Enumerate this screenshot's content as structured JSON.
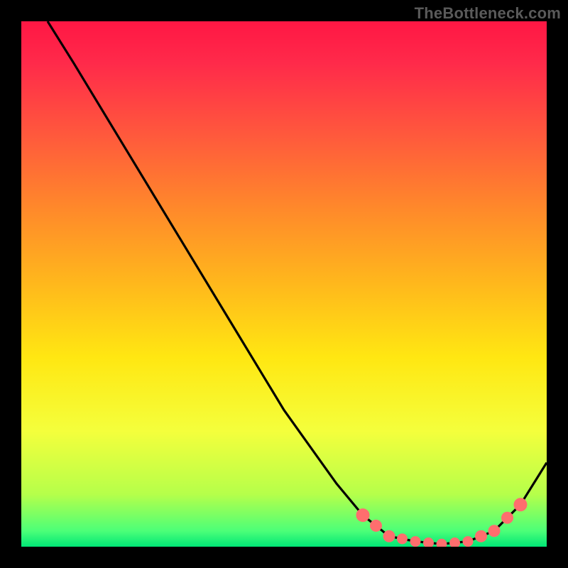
{
  "watermark": "TheBottleneck.com",
  "chart_data": {
    "type": "line",
    "title": "",
    "xlabel": "",
    "ylabel": "",
    "xlim": [
      0,
      100
    ],
    "ylim": [
      0,
      100
    ],
    "grid": false,
    "legend_position": "none",
    "annotations": [
      {
        "text": "TheBottleneck.com",
        "position": "top-right",
        "role": "watermark"
      }
    ],
    "background": {
      "type": "vertical-gradient",
      "stops": [
        {
          "pos": 0.0,
          "color": "#ff1744"
        },
        {
          "pos": 0.5,
          "color": "#ffe712"
        },
        {
          "pos": 0.97,
          "color": "#4cff78"
        },
        {
          "pos": 1.0,
          "color": "#00e676"
        }
      ]
    },
    "series": [
      {
        "name": "bottleneck-curve",
        "color": "#000000",
        "x": [
          5,
          10,
          20,
          30,
          40,
          50,
          60,
          65,
          70,
          75,
          80,
          85,
          90,
          95,
          100
        ],
        "values": [
          100,
          92,
          75.5,
          59,
          42.5,
          26,
          12,
          6,
          2,
          1,
          0.5,
          1,
          3,
          8,
          16
        ]
      }
    ],
    "markers": {
      "color": "#ff6e6e",
      "radius": 8,
      "x": [
        65,
        67.5,
        70,
        72.5,
        75,
        77.5,
        80,
        82.5,
        85,
        87.5,
        90,
        92.5,
        95
      ],
      "y": [
        6,
        4,
        2,
        1.5,
        1,
        0.75,
        0.5,
        0.75,
        1,
        2,
        3,
        5.5,
        8
      ]
    }
  }
}
